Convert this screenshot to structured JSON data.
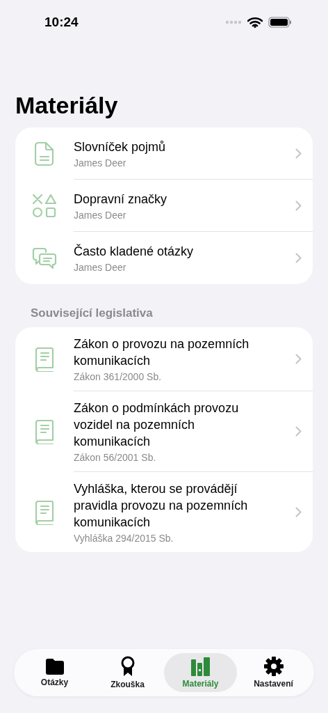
{
  "status_bar": {
    "time": "10:24"
  },
  "title": "Materiály",
  "materials": [
    {
      "kind": "document",
      "title": "Slovníček pojmů",
      "subtitle": "James Deer"
    },
    {
      "kind": "shapes",
      "title": "Dopravní značky",
      "subtitle": "James Deer"
    },
    {
      "kind": "chat",
      "title": "Často kladené otázky",
      "subtitle": "James Deer"
    }
  ],
  "legislation": {
    "header": "Související legislativa",
    "items": [
      {
        "kind": "book",
        "title": "Zákon o provozu na pozemních komunikacích",
        "subtitle": "Zákon 361/2000 Sb."
      },
      {
        "kind": "book",
        "title": "Zákon o podmínkách provozu vozidel na pozemních komunikacích",
        "subtitle": "Zákon 56/2001 Sb."
      },
      {
        "kind": "book",
        "title": "Vyhláška, kterou se provádějí pravidla provozu na pozemních komunikacích",
        "subtitle": "Vyhláška 294/2015 Sb."
      }
    ]
  },
  "tab_bar": [
    {
      "kind": "folder",
      "label": "Otázky",
      "selected": false
    },
    {
      "kind": "award",
      "label": "Zkouška",
      "selected": false
    },
    {
      "kind": "books",
      "label": "Materiály",
      "selected": true
    },
    {
      "kind": "gear",
      "label": "Nastavení",
      "selected": false
    }
  ]
}
